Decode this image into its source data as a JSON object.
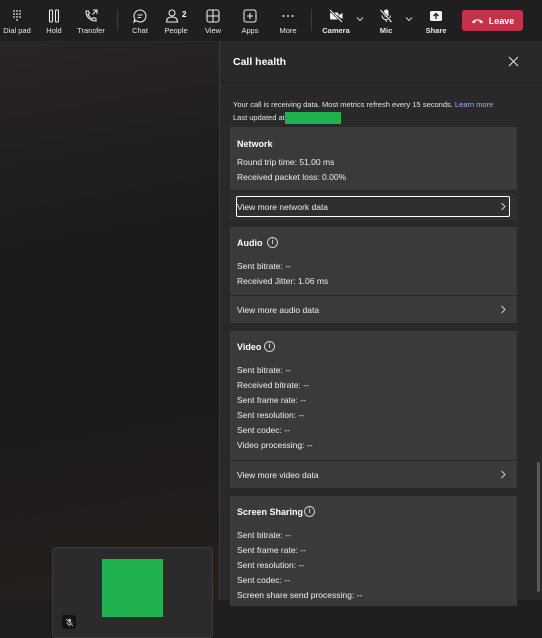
{
  "toolbar": {
    "dial_pad": "Dial pad",
    "hold": "Hold",
    "transfer": "Transfer",
    "chat": "Chat",
    "people": "People",
    "people_count": "2",
    "view": "View",
    "apps": "Apps",
    "more": "More",
    "camera": "Camera",
    "mic": "Mic",
    "share": "Share",
    "leave": "Leave"
  },
  "panel": {
    "title": "Call health",
    "info": "Your call is receiving data. Most metrics refresh every 15 seconds.",
    "learn_more": "Learn more",
    "last_updated": "Last updated at"
  },
  "network": {
    "title": "Network",
    "round_trip": "Round trip time: 51.00 ms",
    "packet_loss": "Received packet loss: 0.00%",
    "view_more": "View more network data"
  },
  "audio": {
    "title": "Audio",
    "sent_bitrate": "Sent bitrate: --",
    "received_jitter": "Received Jitter: 1.06 ms",
    "view_more": "View more audio data"
  },
  "video": {
    "title": "Video",
    "sent_bitrate": "Sent bitrate: --",
    "received_bitrate": "Received bitrate: --",
    "sent_frame_rate": "Sent frame rate: --",
    "sent_resolution": "Sent resolution: --",
    "sent_codec": "Sent codec: --",
    "video_processing": "Video processing: --",
    "view_more": "View more video data"
  },
  "screen_sharing": {
    "title": "Screen Sharing",
    "sent_bitrate": "Sent bitrate: --",
    "sent_frame_rate": "Sent frame rate: --",
    "sent_resolution": "Sent resolution: --",
    "sent_codec": "Sent codec: --",
    "send_processing": "Screen share send processing: --"
  },
  "colors": {
    "leave": "#c4314b",
    "link": "#a8a9ff",
    "placeholder_green": "#21b14f"
  },
  "icons": [
    "dialpad-icon",
    "pause-icon",
    "transfer-icon",
    "chat-icon",
    "people-icon",
    "view-icon",
    "apps-icon",
    "more-icon",
    "camera-off-icon",
    "mic-off-icon",
    "share-icon",
    "phone-hangup-icon",
    "close-icon",
    "info-icon",
    "chevron-right-icon"
  ]
}
